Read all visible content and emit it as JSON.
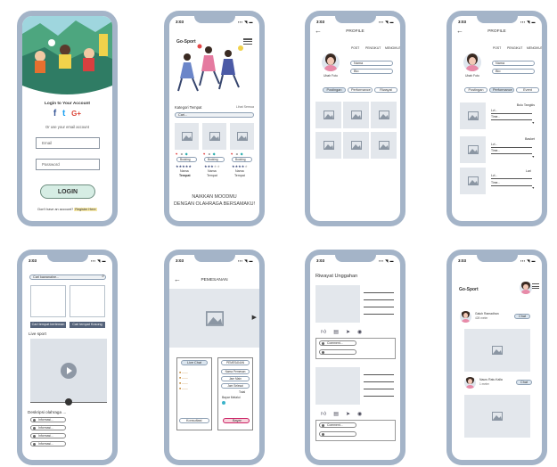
{
  "status_time": "3:03",
  "status_signal": "▪▪▪ ◥ ▬",
  "image_icon": "image-placeholder-icon",
  "colors": {
    "frame": "#a4b4c8",
    "placeholder": "#e3e7ec",
    "accent_button": "#55637a",
    "login_button": "#d6ede4",
    "highlight": "#f7e9a8"
  },
  "login": {
    "title": "Login to Your Account",
    "socials": [
      "f",
      "t",
      "G+"
    ],
    "or_text": "Or use your email account",
    "email_placeholder": "Email",
    "password_placeholder": "Password",
    "button": "LOGIN",
    "signup_prefix": "Don't have an account?",
    "signup_link": "Register Here"
  },
  "home": {
    "brand": "Go-Sport",
    "category_label": "Kategori Tempat",
    "see_all": "Lihat Semua",
    "search_placeholder": "Cari...",
    "cards": [
      {
        "button": "Booking",
        "name": "Nama",
        "sub": "Tempat"
      },
      {
        "button": "Booking",
        "name": "Nama",
        "sub": "Tempat"
      },
      {
        "button": "Booking",
        "name": "Nama",
        "sub": "Tempat"
      }
    ],
    "slogan_1": "NAIKKAN MOODMU",
    "slogan_2": "DENGAN OLAHRAGA BERSAMAKU!"
  },
  "profile": {
    "title": "PROFILE",
    "stats": [
      "POST",
      "PENGIKUT",
      "MENGIKUTI"
    ],
    "name_field": "Nama",
    "bio_field": "Bio",
    "edit": "Ubah Foto",
    "tabs": [
      "Postingan",
      "Performance",
      "Riwayat"
    ],
    "tabs_alt": [
      "Postingan",
      "Performance",
      "Event"
    ]
  },
  "performance": {
    "rows": [
      {
        "sport": "Bulu Tangkis",
        "l1": "Lvl...",
        "l2": "Time..."
      },
      {
        "sport": "Basket",
        "l1": "Lvl...",
        "l2": "Time..."
      },
      {
        "sport": "Lari",
        "l1": "Lvl...",
        "l2": "Time..."
      }
    ]
  },
  "partner": {
    "search_placeholder": "Cari kawanalne...",
    "btn_left": "Cari tempat berteman",
    "btn_right": "Cari tempat Kosong",
    "live_label": "Live sport",
    "desc_label": "Deskripsi olahraga ...",
    "list": [
      "Informasi...",
      "Informasi...",
      "Informasi...",
      "Informasi..."
    ]
  },
  "booking": {
    "title": "PEMESANAN",
    "left_pill": "Live Chat",
    "right_pill": "PEMESANAN",
    "fields": [
      "Nama Pemesan",
      "Jam Main",
      "Jam Selesai",
      "Total"
    ],
    "payment": "Bayar Melalui",
    "left_btn": "Konsultasi",
    "right_btn": "Bayar"
  },
  "history": {
    "title": "Riwayat Unggahan",
    "comment_placeholder": "Comment..."
  },
  "feed": {
    "brand": "Go-Sport",
    "users": [
      {
        "name": "Galuh Ramadhan",
        "meta": "428 meter",
        "button": "Chat"
      },
      {
        "name": "Nauru Ratu Kalla",
        "meta": "1 meter",
        "button": "Chat"
      }
    ]
  }
}
